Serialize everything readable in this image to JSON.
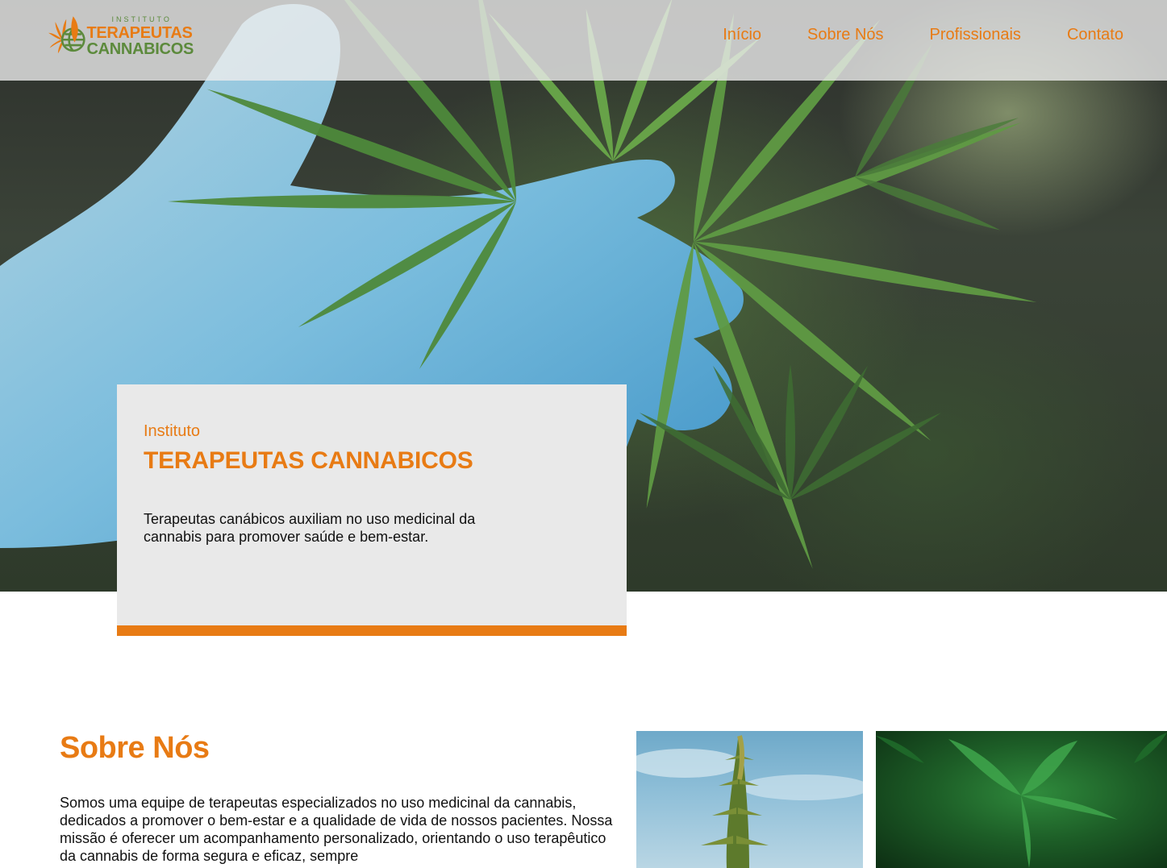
{
  "logo": {
    "small": "INSTITUTO",
    "line1": "TERAPEUTAS",
    "line2": "CANNABICOS"
  },
  "nav": {
    "items": [
      {
        "label": "Início"
      },
      {
        "label": "Sobre Nós"
      },
      {
        "label": "Profissionais"
      },
      {
        "label": "Contato"
      }
    ]
  },
  "hero": {
    "kicker": "Instituto",
    "title": "TERAPEUTAS CANNABICOS",
    "text": "Terapeutas canábicos auxiliam no uso medicinal da cannabis para promover saúde e bem-estar."
  },
  "about": {
    "title": "Sobre Nós",
    "text": "Somos uma equipe de terapeutas especializados no uso medicinal da cannabis, dedicados a promover o bem-estar e a qualidade de vida de nossos pacientes. Nossa missão é oferecer um acompanhamento personalizado, orientando o uso terapêutico da cannabis de forma segura e eficaz, sempre"
  },
  "colors": {
    "accent": "#e87b14",
    "green": "#5c8a3c"
  }
}
